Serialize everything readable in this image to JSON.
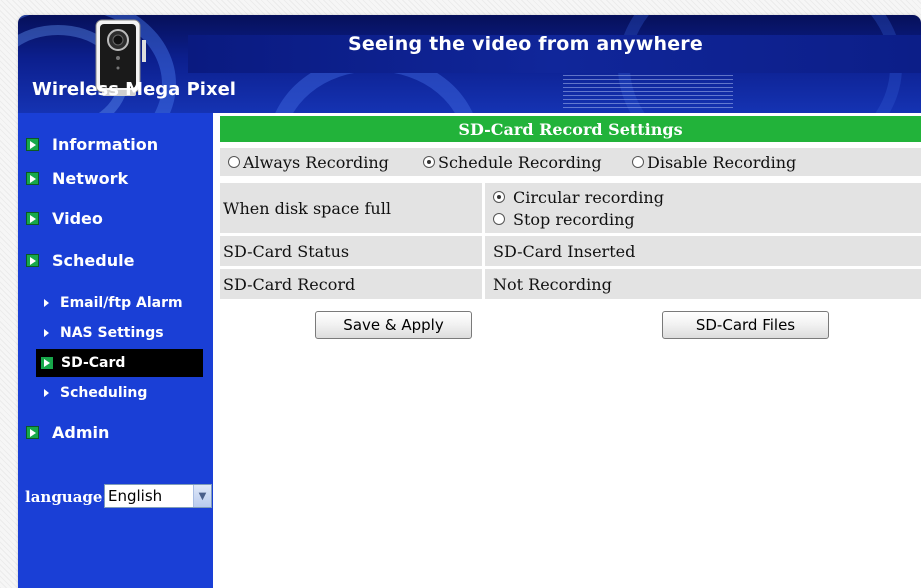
{
  "banner": {
    "title": "Seeing the video from anywhere",
    "brand": "Wireless Mega Pixel"
  },
  "sidebar": {
    "items": [
      {
        "label": "Information"
      },
      {
        "label": "Network"
      },
      {
        "label": "Video"
      },
      {
        "label": "Schedule"
      },
      {
        "label": "Admin"
      }
    ],
    "subitems": [
      {
        "label": "Email/ftp Alarm"
      },
      {
        "label": "NAS Settings"
      },
      {
        "label": "SD-Card",
        "active": true
      },
      {
        "label": "Scheduling"
      }
    ],
    "language_label": "language:",
    "language_value": "English"
  },
  "main": {
    "title": "SD-Card Record Settings",
    "record_modes": [
      {
        "label": "Always Recording",
        "selected": false
      },
      {
        "label": "Schedule Recording",
        "selected": true
      },
      {
        "label": "Disable Recording",
        "selected": false
      }
    ],
    "disk_full": {
      "label": "When disk space full",
      "options": [
        {
          "label": "Circular recording",
          "selected": true
        },
        {
          "label": "Stop recording",
          "selected": false
        }
      ]
    },
    "status": {
      "label": "SD-Card Status",
      "value": "SD-Card Inserted"
    },
    "record": {
      "label": "SD-Card Record",
      "value": "Not Recording"
    },
    "buttons": {
      "save": "Save & Apply",
      "files": "SD-Card Files"
    }
  },
  "colors": {
    "sidebar": "#1a3fd6",
    "header_green": "#22b33a",
    "row_gray": "#e3e3e3",
    "active_nav": "#000000"
  }
}
